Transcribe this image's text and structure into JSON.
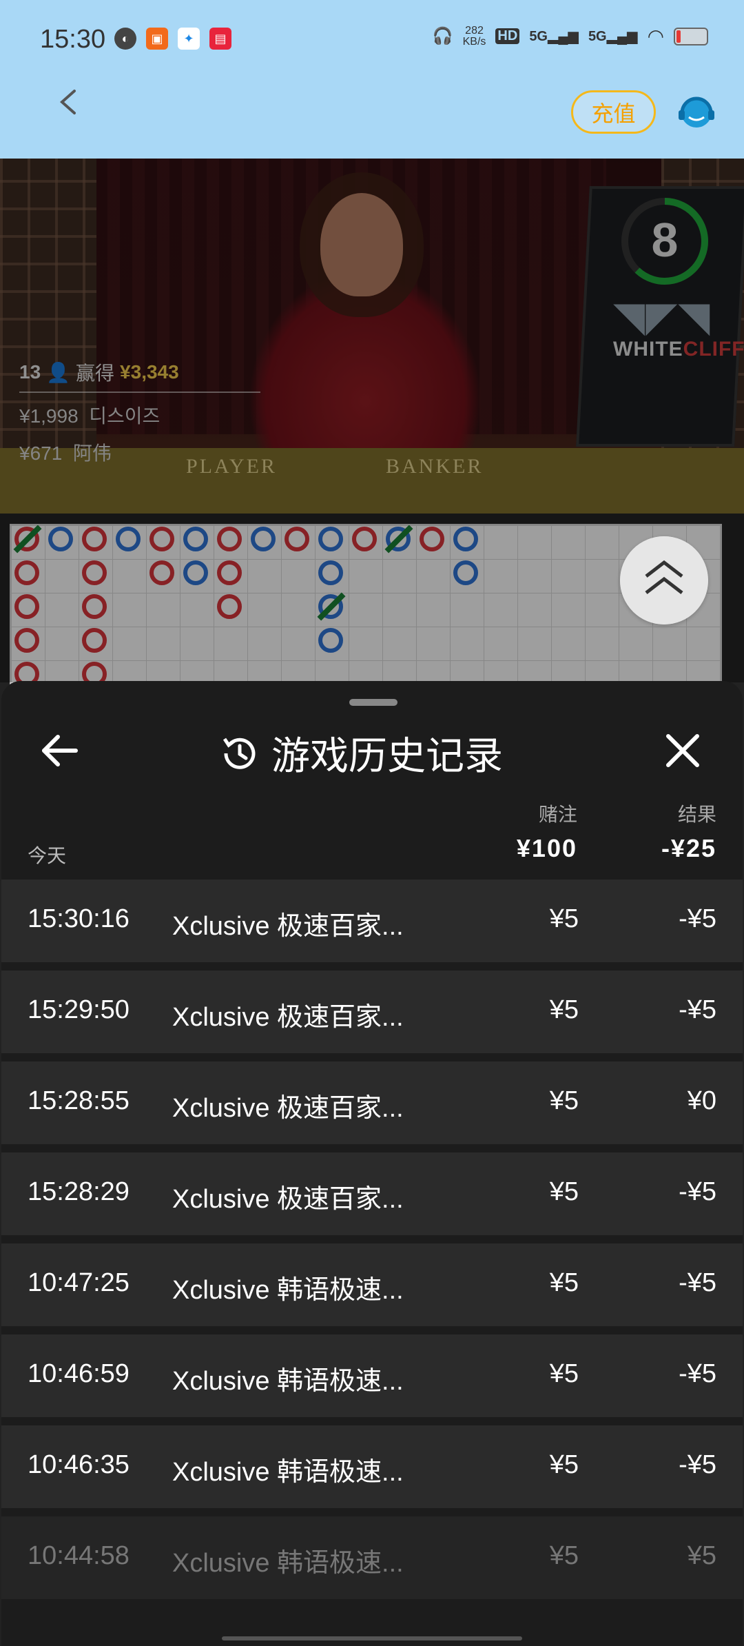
{
  "status_bar": {
    "time": "15:30",
    "net_speed_value": "282",
    "net_speed_unit": "KB/s",
    "hd_label": "HD",
    "net_a": "5G",
    "net_b": "5G"
  },
  "header": {
    "recharge_label": "充值"
  },
  "video": {
    "countdown": "8",
    "brand_a": "WHITE",
    "brand_b": "CLIFF",
    "player_count": "13",
    "win_label": "赢得",
    "win_amount": "¥3,343",
    "winners": [
      {
        "amount": "¥1,998",
        "name": "디스이즈"
      },
      {
        "amount": "¥671",
        "name": "阿伟"
      }
    ],
    "table_left": "PLAYER",
    "table_right": "BANKER"
  },
  "history": {
    "title": "游戏历史记录",
    "bet_header": "赌注",
    "result_header": "结果",
    "today_label": "今天",
    "total_bet": "¥100",
    "total_result": "-¥25",
    "rows": [
      {
        "time": "15:30:16",
        "game": "Xclusive 极速百家...",
        "bet": "¥5",
        "result": "-¥5"
      },
      {
        "time": "15:29:50",
        "game": "Xclusive 极速百家...",
        "bet": "¥5",
        "result": "-¥5"
      },
      {
        "time": "15:28:55",
        "game": "Xclusive 极速百家...",
        "bet": "¥5",
        "result": "¥0"
      },
      {
        "time": "15:28:29",
        "game": "Xclusive 极速百家...",
        "bet": "¥5",
        "result": "-¥5"
      },
      {
        "time": "10:47:25",
        "game": "Xclusive 韩语极速...",
        "bet": "¥5",
        "result": "-¥5"
      },
      {
        "time": "10:46:59",
        "game": "Xclusive 韩语极速...",
        "bet": "¥5",
        "result": "-¥5"
      },
      {
        "time": "10:46:35",
        "game": "Xclusive 韩语极速...",
        "bet": "¥5",
        "result": "-¥5"
      },
      {
        "time": "10:44:58",
        "game": "Xclusive 韩语极速...",
        "bet": "¥5",
        "result": "¥5"
      }
    ]
  },
  "colors": {
    "accent_gold": "#f5b81a",
    "banker_red": "#d0343a",
    "player_blue": "#2d6fcc",
    "tie_green": "#1a7b34"
  }
}
